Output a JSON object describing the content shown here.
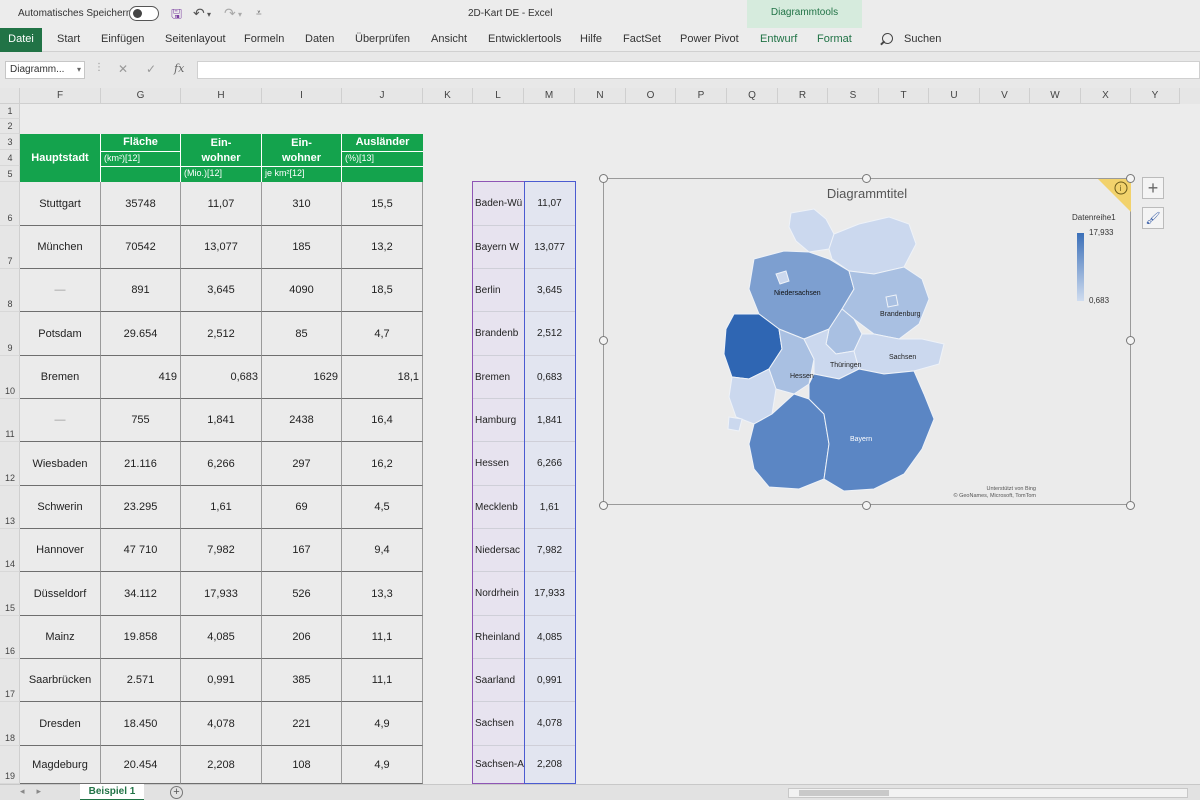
{
  "titlebar": {
    "autosave_label": "Automatisches Speichern",
    "doc_title": "2D-Kart DE  -  Excel",
    "context_tab": "Diagrammtools"
  },
  "ribbon": {
    "tabs": [
      "Datei",
      "Start",
      "Einfügen",
      "Seitenlayout",
      "Formeln",
      "Daten",
      "Überprüfen",
      "Ansicht",
      "Entwicklertools",
      "Hilfe",
      "FactSet",
      "Power Pivot",
      "Entwurf",
      "Format"
    ],
    "search_label": "Suchen"
  },
  "formula_bar": {
    "name_box": "Diagramm...",
    "cancel_glyph": "✕",
    "enter_glyph": "✓",
    "fx_glyph": "fx",
    "value": ""
  },
  "columns": [
    "F",
    "G",
    "H",
    "I",
    "J",
    "K",
    "L",
    "M",
    "N",
    "O",
    "P",
    "Q",
    "R",
    "S",
    "T",
    "U",
    "V",
    "W",
    "X",
    "Y"
  ],
  "rows": [
    "1",
    "2",
    "3",
    "4",
    "5",
    "6",
    "7",
    "8",
    "9",
    "10",
    "11",
    "12",
    "13",
    "14",
    "15",
    "16",
    "17",
    "18",
    "19"
  ],
  "table": {
    "headers": {
      "hauptstadt": "Hauptstadt",
      "flaeche": "Fläche",
      "flaeche_sub": "(km²)[12]",
      "einwohner": "Ein-\nwohner",
      "einwohner_sub": "(Mio.)[12]",
      "dichte": "Ein-\nwohner",
      "dichte_sub": "je km²[12]",
      "auslaender": "Ausländer",
      "auslaender_sub": "(%)[13]"
    },
    "rows": [
      [
        "Stuttgart",
        "35748",
        "11,07",
        "310",
        "15,5"
      ],
      [
        "München",
        "70542",
        "13,077",
        "185",
        "13,2"
      ],
      [
        "—",
        "891",
        "3,645",
        "4090",
        "18,5"
      ],
      [
        "Potsdam",
        "29.654",
        "2,512",
        "85",
        "4,7"
      ],
      [
        "Bremen",
        "419",
        "0,683",
        "1629",
        "18,1"
      ],
      [
        "—",
        "755",
        "1,841",
        "2438",
        "16,4"
      ],
      [
        "Wiesbaden",
        "21.116",
        "6,266",
        "297",
        "16,2"
      ],
      [
        "Schwerin",
        "23.295",
        "1,61",
        "69",
        "4,5"
      ],
      [
        "Hannover",
        "47 710",
        "7,982",
        "167",
        "9,4"
      ],
      [
        "Düsseldorf",
        "34.112",
        "17,933",
        "526",
        "13,3"
      ],
      [
        "Mainz",
        "19.858",
        "4,085",
        "206",
        "11,1"
      ],
      [
        "Saarbrücken",
        "2.571",
        "0,991",
        "385",
        "11,1"
      ],
      [
        "Dresden",
        "18.450",
        "4,078",
        "221",
        "4,9"
      ],
      [
        "Magdeburg",
        "20.454",
        "2,208",
        "108",
        "4,9"
      ]
    ]
  },
  "data_columns": {
    "states": [
      "Baden-Wü",
      "Bayern W",
      "Berlin",
      "Brandenb",
      "Bremen",
      "Hamburg",
      "Hessen",
      "Mecklenb",
      "Niedersac",
      "Nordrhein",
      "Rheinland",
      "Saarland",
      "Sachsen",
      "Sachsen-A"
    ],
    "values": [
      "11,07",
      "13,077",
      "3,645",
      "2,512",
      "0,683",
      "1,841",
      "6,266",
      "1,61",
      "7,982",
      "17,933",
      "4,085",
      "0,991",
      "4,078",
      "2,208"
    ]
  },
  "chart": {
    "title": "Diagrammtitel",
    "legend_title": "Datenreihe1",
    "legend_max": "17,933",
    "legend_min": "0,683",
    "credit_line1": "Unterstützt von Bing",
    "credit_line2": "© GeoNames, Microsoft, TomTom",
    "region_labels": {
      "niedersachsen": "Niedersachsen",
      "brandenburg": "Brandenburg",
      "sachsen": "Sachsen",
      "thueringen": "Thüringen",
      "hessen": "Hessen",
      "bayern": "Bayern"
    },
    "colors": {
      "darkest": "#2f66b3",
      "dark": "#5b86c4",
      "mid": "#7d9fd0",
      "light": "#a9c0e2",
      "lightest": "#cbd8ee"
    }
  },
  "sheets": {
    "active": "Beispiel 1"
  },
  "colors": {
    "excel_green": "#217346",
    "table_header_green": "#14a34d"
  }
}
